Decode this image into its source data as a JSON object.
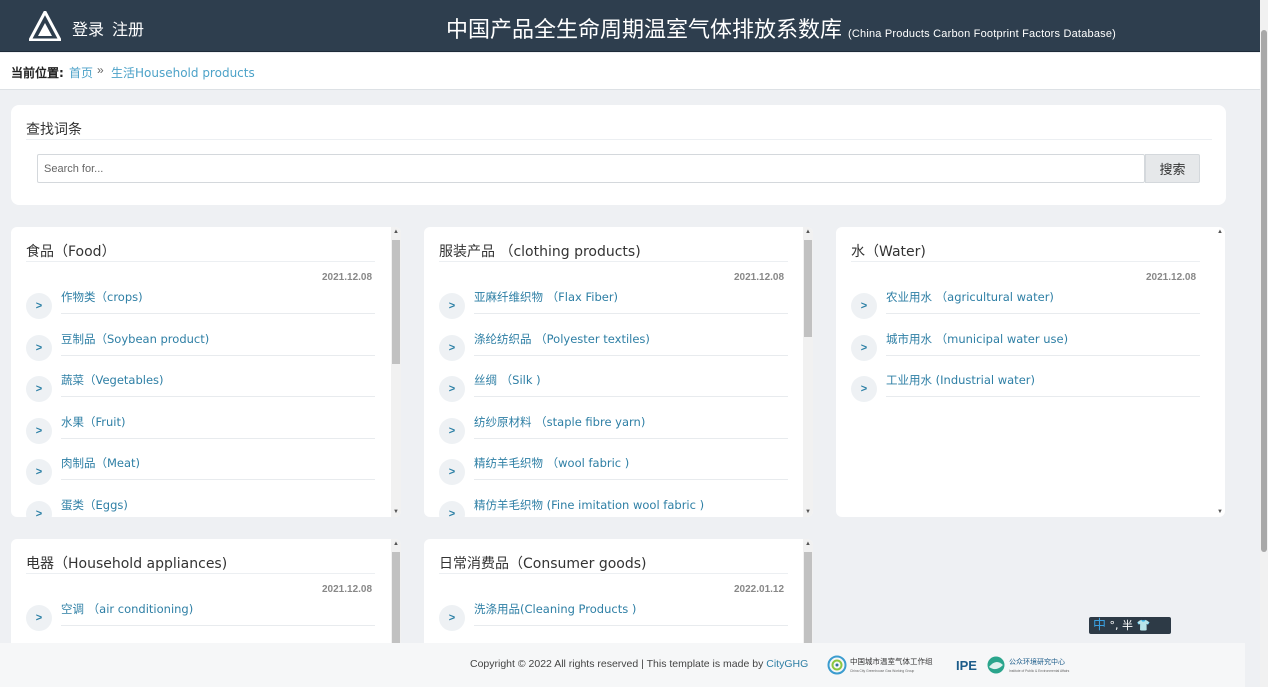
{
  "header": {
    "login": "登录",
    "register": "注册",
    "title": "中国产品全生命周期温室气体排放系数库",
    "title_en": "(China Products Carbon Footprint Factors Database)"
  },
  "breadcrumb": {
    "label": "当前位置:",
    "home": "首页",
    "sep": "»",
    "current": "生活Household products"
  },
  "search": {
    "heading": "查找词条",
    "placeholder": "Search for...",
    "button": "搜索"
  },
  "cards": [
    {
      "title": "食品（Food）",
      "date": "2021.12.08",
      "items": [
        "作物类（crops)",
        "豆制品（Soybean product)",
        "蔬菜（Vegetables)",
        "水果（Fruit)",
        "肉制品（Meat)",
        "蛋类（Eggs)"
      ]
    },
    {
      "title": "服装产品 （clothing products)",
      "date": "2021.12.08",
      "items": [
        "亚麻纤维织物 （Flax Fiber)",
        "涤纶纺织品 （Polyester textiles)",
        "丝绸 （Silk )",
        "纺纱原材料 （staple fibre yarn)",
        "精纺羊毛织物 （wool fabric )",
        "精仿羊毛织物 (Fine imitation wool fabric )"
      ]
    },
    {
      "title": "水（Water)",
      "date": "2021.12.08",
      "items": [
        "农业用水 （agricultural water)",
        "城市用水 （municipal water use)",
        "工业用水 (Industrial water)"
      ]
    },
    {
      "title": "电器（Household appliances)",
      "date": "2021.12.08",
      "items": [
        "空调 （air conditioning)"
      ]
    },
    {
      "title": "日常消费品（Consumer goods)",
      "date": "2022.01.12",
      "items": [
        "洗涤用品(Cleaning Products )"
      ]
    }
  ],
  "ime": {
    "mode": "中",
    "punct": "°,",
    "width": "半"
  },
  "footer": {
    "copyright": "Copyright © 2022 All rights reserved | This template is made by",
    "link": "CityGHG",
    "logo1_name": "中国城市温室气体工作组",
    "logo1_sub": "China City Greenhouse Gas Working Group",
    "logo2_abbr": "IPE",
    "logo2_name": "公众环境研究中心",
    "logo2_sub": "Institute of Public & Environmental Affairs"
  },
  "colors": {
    "header_bg": "#2e3e4e",
    "link": "#2e7fa5",
    "page_bg": "#eef0f3"
  }
}
